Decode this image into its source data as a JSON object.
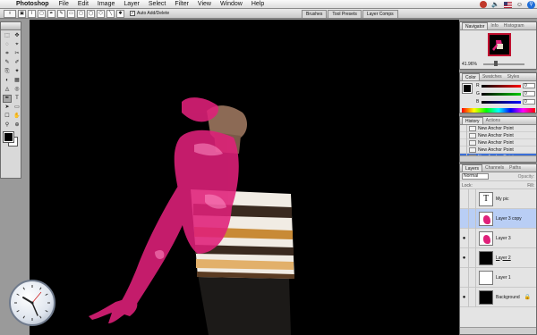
{
  "menubar": {
    "apple_glyph": "",
    "app_name": "Photoshop",
    "items": [
      "File",
      "Edit",
      "Image",
      "Layer",
      "Select",
      "Filter",
      "View",
      "Window",
      "Help"
    ]
  },
  "options_bar": {
    "tool_glyph": "♁",
    "auto_add_delete_label": "Auto Add/Delete",
    "auto_add_delete_checked": true,
    "well_tabs": [
      "Brushes",
      "Tool Presets",
      "Layer Comps"
    ]
  },
  "toolbox": {
    "tools": [
      "⬚",
      "✥",
      "◌",
      "⌖",
      "⌗",
      "✂",
      "✎",
      "✐",
      "⎘",
      "✦",
      "◐",
      "▦",
      "◬",
      "◎",
      "✒",
      "T",
      "➤",
      "▭",
      "☐",
      "✋",
      "⚲",
      "⊕"
    ],
    "foreground_color": "#000000",
    "background_color": "#ffffff"
  },
  "navigator": {
    "tabs": [
      "Navigator",
      "Info",
      "Histogram"
    ],
    "zoom": "41.96%"
  },
  "color_palette": {
    "tabs": [
      "Color",
      "Swatches",
      "Styles"
    ],
    "channels": [
      {
        "label": "R",
        "value": "0",
        "gradient": "linear-gradient(90deg,#000,#f00)"
      },
      {
        "label": "G",
        "value": "0",
        "gradient": "linear-gradient(90deg,#000,#0c0)"
      },
      {
        "label": "B",
        "value": "0",
        "gradient": "linear-gradient(90deg,#000,#00f)"
      }
    ]
  },
  "history": {
    "tabs": [
      "History",
      "Actions"
    ],
    "items": [
      "New Anchor Point",
      "New Anchor Point",
      "New Anchor Point",
      "New Anchor Point",
      "New Anchor Point"
    ],
    "selected_index": 4
  },
  "layers": {
    "tabs": [
      "Layers",
      "Channels",
      "Paths"
    ],
    "blend_mode": "Normal",
    "opacity_label": "Opacity:",
    "lock_label": "Lock:",
    "fill_label": "Fill:",
    "items": [
      {
        "name": "My pic",
        "thumb": "text",
        "visible": false
      },
      {
        "name": "Layer 3 copy",
        "thumb": "pink",
        "visible": false,
        "selected": true
      },
      {
        "name": "Layer 3",
        "thumb": "pink",
        "visible": true
      },
      {
        "name": "Layer 2",
        "thumb": "dark",
        "visible": true,
        "underline": true
      },
      {
        "name": "Layer 1",
        "thumb": "plain",
        "visible": false
      },
      {
        "name": "Background",
        "thumb": "dark",
        "visible": true,
        "locked": true
      }
    ]
  },
  "colors": {
    "accent": "#e0207a",
    "selection": "#3a6fd8"
  }
}
